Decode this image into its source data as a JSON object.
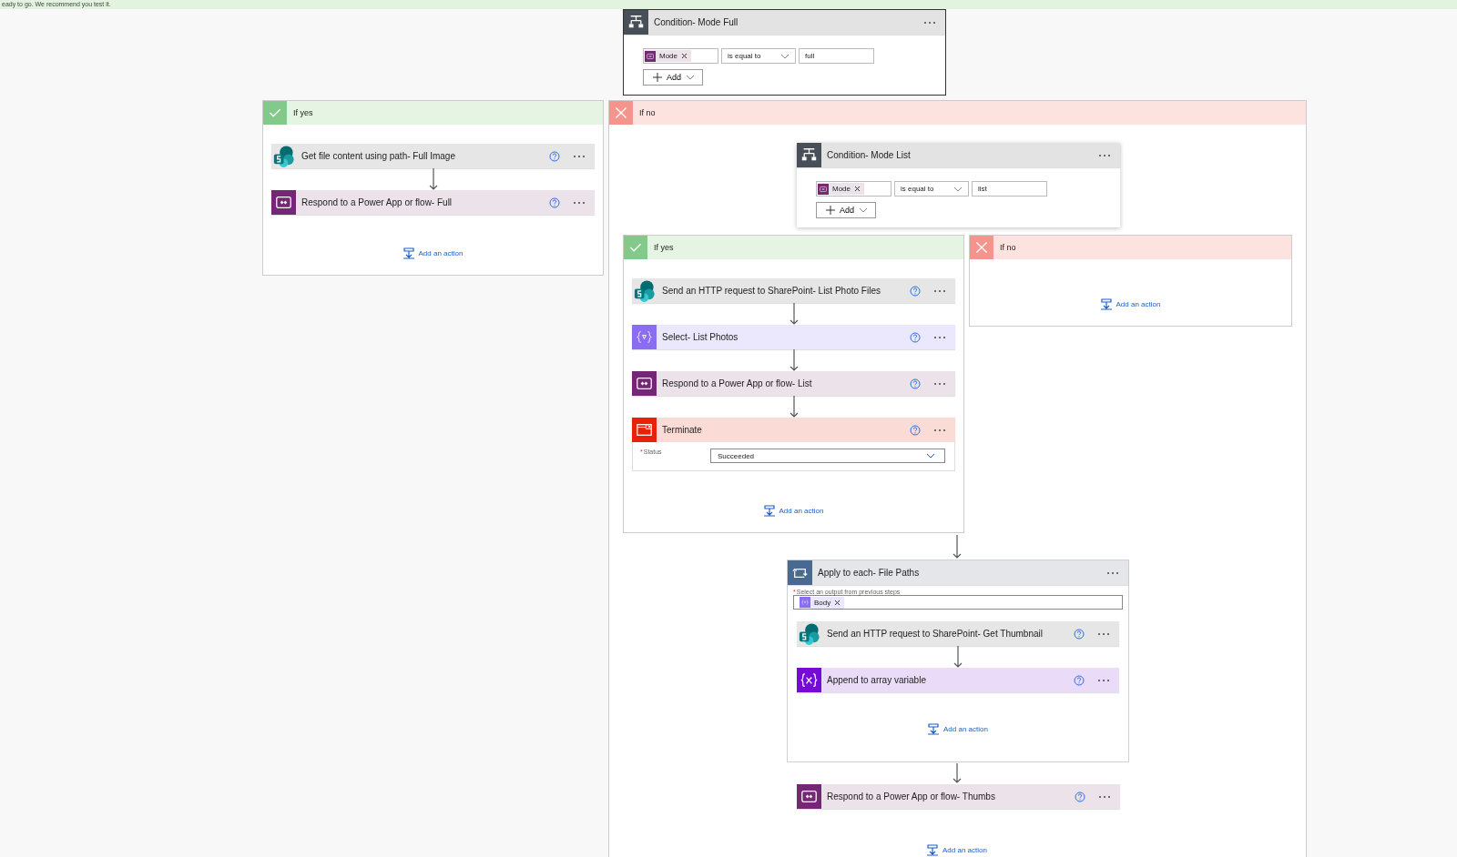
{
  "banner": {
    "text": "eady to go. We recommend you test it."
  },
  "condition": {
    "kind": "condition",
    "title": "Condition- Mode Full",
    "selected": true,
    "rule": {
      "token": "Mode",
      "operator": "is equal to",
      "value": "full"
    },
    "add_button": "Add"
  },
  "if_yes": {
    "kind": "yes",
    "label": "If yes",
    "actions": [
      {
        "kind": "sharepoint",
        "title": "Get file content using path- Full Image"
      },
      {
        "kind": "respond",
        "title": "Respond to a Power App or flow- Full"
      }
    ],
    "add_action": "Add an action"
  },
  "if_no": {
    "kind": "no",
    "label": "If no",
    "condition": {
      "kind": "condition",
      "title": "Condition- Mode List",
      "selected": false,
      "rule": {
        "token": "Mode",
        "operator": "is equal to",
        "value": "list"
      },
      "add_button": "Add"
    },
    "if_yes": {
      "kind": "yes",
      "label": "If yes",
      "actions": [
        {
          "kind": "sharepoint",
          "title": "Send an HTTP request to SharePoint- List Photo Files"
        },
        {
          "kind": "select",
          "title": "Select- List Photos"
        },
        {
          "kind": "respond",
          "title": "Respond to a Power App or flow- List"
        },
        {
          "kind": "terminate",
          "title": "Terminate",
          "field": {
            "required_mark": "*",
            "label": "Status",
            "value": "Succeeded"
          }
        }
      ],
      "add_action": "Add an action"
    },
    "if_no": {
      "kind": "no",
      "label": "If no",
      "add_action": "Add an action"
    },
    "apply_to_each": {
      "kind": "apply",
      "title": "Apply to each- File Paths",
      "field": {
        "required_mark": "*",
        "label": "Select an output from previous steps",
        "token": "Body"
      },
      "actions": [
        {
          "kind": "sharepoint",
          "title": "Send an HTTP request to SharePoint- Get Thumbnail"
        },
        {
          "kind": "variable",
          "title": "Append to array variable"
        }
      ],
      "add_action": "Add an action"
    },
    "after": [
      {
        "kind": "respond",
        "title": "Respond to a Power App or flow- Thumbs"
      }
    ],
    "add_action": "Add an action"
  }
}
